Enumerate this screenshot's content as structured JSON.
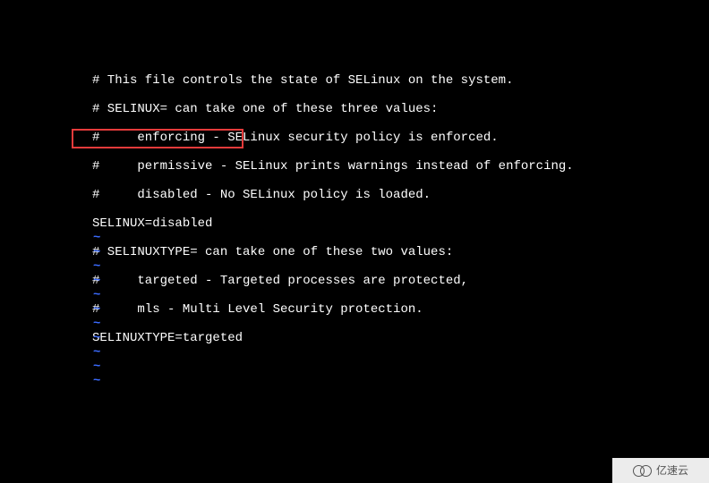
{
  "lines": {
    "l0": "# This file controls the state of SELinux on the system.",
    "l1": "# SELINUX= can take one of these three values:",
    "l2": "#     enforcing - SELinux security policy is enforced.",
    "l3": "#     permissive - SELinux prints warnings instead of enforcing.",
    "l4": "#     disabled - No SELinux policy is loaded.",
    "l5": "SELINUX=disabled",
    "l6": "# SELINUXTYPE= can take one of these two values:",
    "l7": "#     targeted - Targeted processes are protected,",
    "l8": "#     mls - Multi Level Security protection.",
    "l9": "SELINUXTYPE=targeted"
  },
  "highlight": {
    "top": "144",
    "left": "80",
    "width": "192",
    "height": "22"
  },
  "tildes": {
    "char": "~"
  },
  "watermark": {
    "text": "亿速云"
  }
}
